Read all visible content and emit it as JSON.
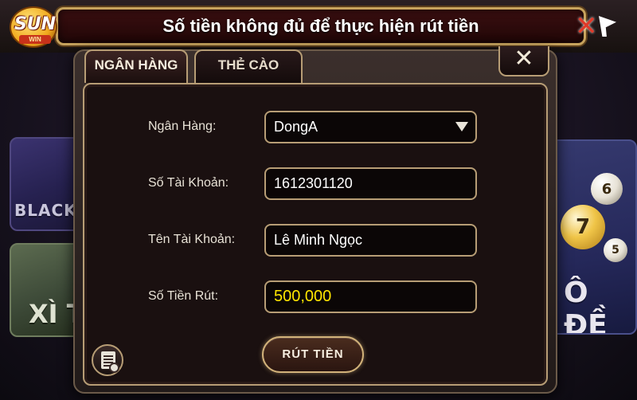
{
  "banner": {
    "message": "Số tiền không đủ để thực hiện rút tiền",
    "logo_text": "SUN",
    "logo_sub": "WIN"
  },
  "background": {
    "tile_left_top": "BLACK",
    "tile_left_bottom": "XÌ T",
    "tile_right": "Ô ĐỀ",
    "balls": [
      "6",
      "7",
      "5"
    ]
  },
  "dialog": {
    "tabs": [
      {
        "label": "NGÂN HÀNG",
        "active": true
      },
      {
        "label": "THẺ CÀO",
        "active": false
      }
    ],
    "close_label": "✕",
    "fields": [
      {
        "label": "Ngân Hàng:",
        "value": "DongA",
        "type": "select"
      },
      {
        "label": "Số Tài Khoản:",
        "value": "1612301120",
        "type": "text"
      },
      {
        "label": "Tên Tài Khoản:",
        "value": "Lê Minh Ngọc",
        "type": "text"
      },
      {
        "label": "Số Tiền Rút:",
        "value": "500,000",
        "type": "money"
      }
    ],
    "submit_label": "RÚT TIỀN"
  },
  "colors": {
    "gold_border": "#b79d75",
    "money_text": "#ffe600",
    "banner_bg": "#3a0e10"
  },
  "icons": {
    "close": "close-icon",
    "dropdown": "chevron-down-icon",
    "history": "history-icon",
    "banner_right": "x-arrow-icon"
  }
}
